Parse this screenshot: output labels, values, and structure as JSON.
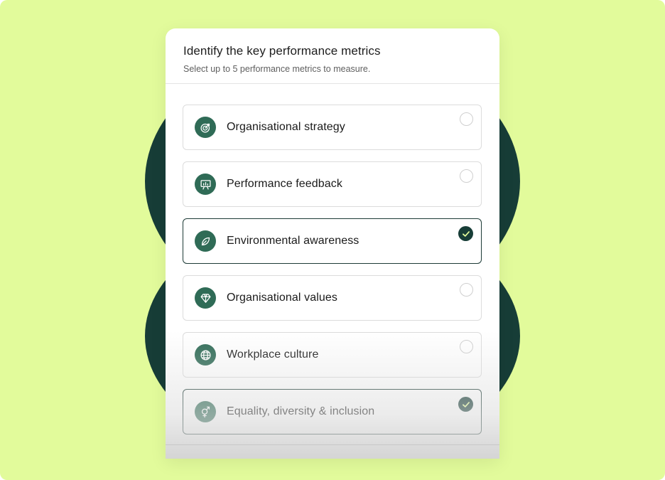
{
  "dialog": {
    "title": "Identify the key performance metrics",
    "subtitle": "Select up to 5 performance metrics to measure."
  },
  "options": [
    {
      "label": "Organisational strategy",
      "icon": "target-icon",
      "selected": false
    },
    {
      "label": "Performance feedback",
      "icon": "presentation-board-icon",
      "selected": false
    },
    {
      "label": "Environmental awareness",
      "icon": "leaf-icon",
      "selected": true
    },
    {
      "label": "Organisational values",
      "icon": "diamond-icon",
      "selected": false
    },
    {
      "label": "Workplace culture",
      "icon": "globe-icon",
      "selected": false
    },
    {
      "label": "Equality, diversity & inclusion",
      "icon": "gender-symbol-icon",
      "selected": true
    }
  ],
  "colors": {
    "background": "#e2fb9b",
    "accent_dark": "#173d37",
    "icon_circle": "#2f6b56"
  }
}
